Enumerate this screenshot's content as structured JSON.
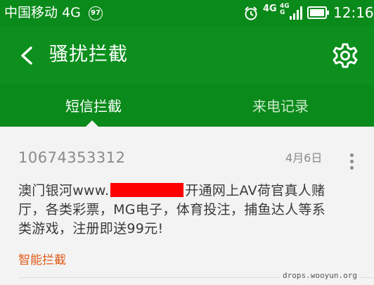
{
  "status_bar": {
    "carrier": "中国移动 4G",
    "carrier_badge": "97",
    "net_primary": "4G",
    "net_secondary_top": "4G",
    "net_secondary_bottom": "G",
    "time": "12:16",
    "icons": [
      "alarm-icon",
      "signal-icon",
      "battery-icon"
    ]
  },
  "app_bar": {
    "title": "骚扰拦截",
    "icons": [
      "back-arrow-icon",
      "gear-icon"
    ]
  },
  "tabs": [
    {
      "label": "短信拦截",
      "active": true
    },
    {
      "label": "来电记录",
      "active": false
    }
  ],
  "message": {
    "sender": "10674353312",
    "date": "4月6日",
    "body_before": "澳门银河www.",
    "body_after": "开通网上AV荷官真人赌厅，各类彩票，MG电子，体育投注，捕鱼达人等系类游戏，注册即送99元!",
    "tag": "智能拦截"
  },
  "watermark": "drops.wooyun.org",
  "colors": {
    "primary_green": "#0c8f1d",
    "tag_orange": "#e05a1a",
    "redaction_red": "#ff0000"
  }
}
